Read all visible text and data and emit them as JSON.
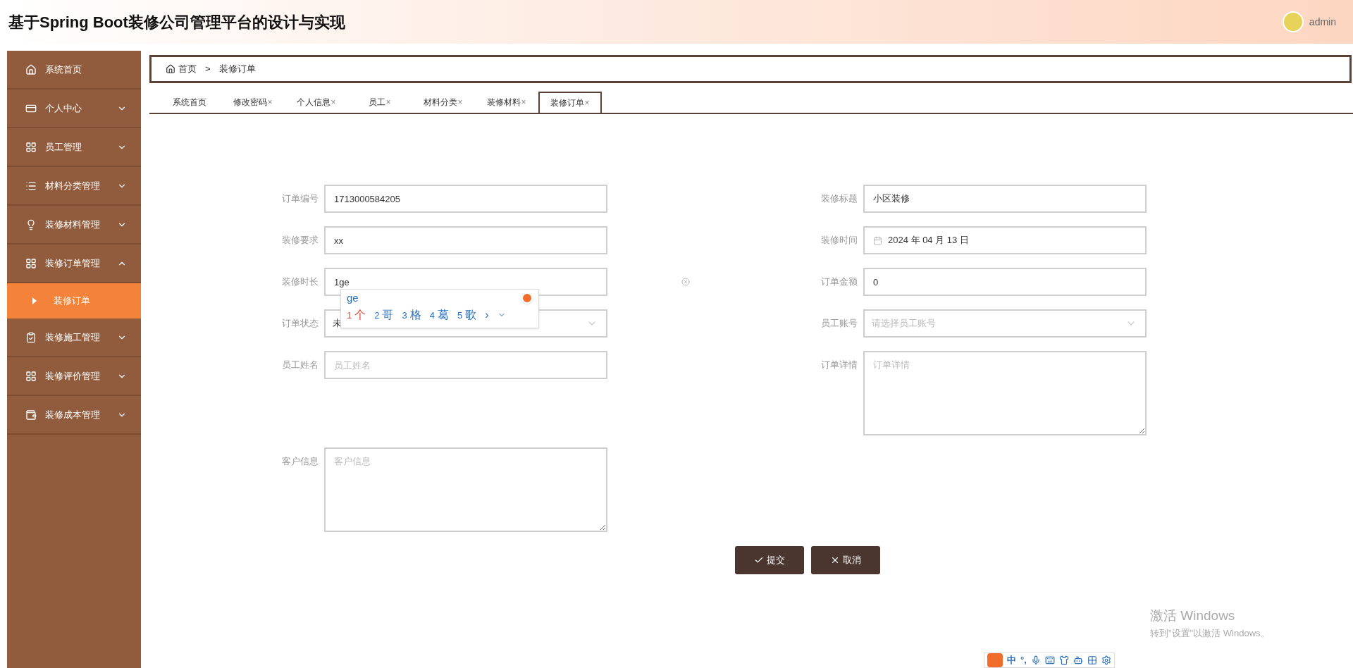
{
  "header": {
    "title": "基于Spring Boot装修公司管理平台的设计与实现",
    "user": "admin"
  },
  "sidebar": {
    "items": [
      {
        "label": "系统首页",
        "kind": "link"
      },
      {
        "label": "个人中心",
        "kind": "menu",
        "expanded": false
      },
      {
        "label": "员工管理",
        "kind": "menu",
        "expanded": false
      },
      {
        "label": "材料分类管理",
        "kind": "menu",
        "expanded": false
      },
      {
        "label": "装修材料管理",
        "kind": "menu",
        "expanded": false
      },
      {
        "label": "装修订单管理",
        "kind": "menu",
        "expanded": true,
        "children": [
          {
            "label": "装修订单",
            "selected": true
          }
        ]
      },
      {
        "label": "装修施工管理",
        "kind": "menu",
        "expanded": false
      },
      {
        "label": "装修评价管理",
        "kind": "menu",
        "expanded": false
      },
      {
        "label": "装修成本管理",
        "kind": "menu",
        "expanded": false
      }
    ]
  },
  "breadcrumb": {
    "home": "首页",
    "separator": ">",
    "current": "装修订单"
  },
  "tabs": [
    {
      "label": "系统首页",
      "closable": false,
      "selected": false
    },
    {
      "label": "修改密码",
      "closable": true,
      "selected": false
    },
    {
      "label": "个人信息",
      "closable": true,
      "selected": false
    },
    {
      "label": "员工",
      "closable": true,
      "selected": false
    },
    {
      "label": "材料分类",
      "closable": true,
      "selected": false
    },
    {
      "label": "装修材料",
      "closable": true,
      "selected": false
    },
    {
      "label": "装修订单",
      "closable": true,
      "selected": true
    }
  ],
  "tab_close": "×",
  "form": {
    "left": [
      {
        "label": "订单编号",
        "kind": "text",
        "value": "1713000584205"
      },
      {
        "label": "装修要求",
        "kind": "text",
        "value": "xx"
      },
      {
        "label": "装修时长",
        "kind": "text",
        "value": "1ge"
      },
      {
        "label": "订单状态",
        "kind": "select",
        "value": "未"
      },
      {
        "label": "员工姓名",
        "kind": "text",
        "placeholder": "员工姓名"
      },
      {
        "label": "客户信息",
        "kind": "textarea",
        "placeholder": "客户信息"
      }
    ],
    "right": [
      {
        "label": "装修标题",
        "kind": "text",
        "value": "小区装修"
      },
      {
        "label": "装修时间",
        "kind": "date",
        "value": "2024 年 04 月 13 日"
      },
      {
        "label": "订单金额",
        "kind": "text",
        "value": "0"
      },
      {
        "label": "员工账号",
        "kind": "select",
        "placeholder": "请选择员工账号"
      },
      {
        "label": "订单详情",
        "kind": "textarea",
        "placeholder": "订单详情"
      }
    ],
    "buttons": [
      {
        "label": "提交",
        "kind": "submit"
      },
      {
        "label": "取消",
        "kind": "cancel"
      }
    ]
  },
  "ime": {
    "composition": "ge",
    "candidates": [
      {
        "num": "1",
        "text": "个",
        "selected": true
      },
      {
        "num": "2",
        "text": "哥",
        "selected": false
      },
      {
        "num": "3",
        "text": "格",
        "selected": false
      },
      {
        "num": "4",
        "text": "葛",
        "selected": false
      },
      {
        "num": "5",
        "text": "歌",
        "selected": false
      }
    ],
    "next": "›"
  },
  "ime_toolbar": {
    "items": [
      "中",
      "°,"
    ]
  },
  "activation": {
    "title": "激活 Windows",
    "subtitle": "转到\"设置\"以激活 Windows。"
  }
}
